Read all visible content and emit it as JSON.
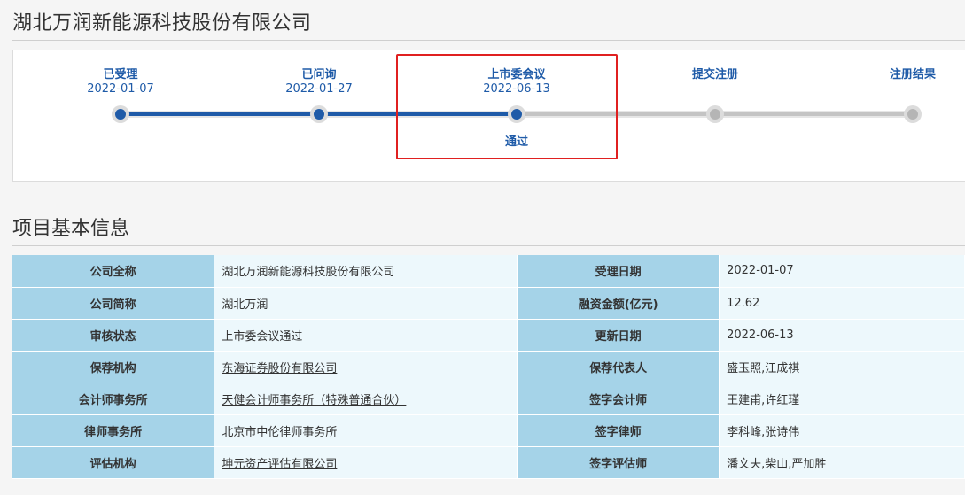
{
  "company_title": "湖北万润新能源科技股份有限公司",
  "steps": [
    {
      "label": "已受理",
      "date": "2022-01-07",
      "state": "done"
    },
    {
      "label": "已问询",
      "date": "2022-01-27",
      "state": "done"
    },
    {
      "label": "上市委会议",
      "date": "2022-06-13",
      "state": "done",
      "result": "通过"
    },
    {
      "label": "提交注册",
      "date": "",
      "state": "todo"
    },
    {
      "label": "注册结果",
      "date": "",
      "state": "todo"
    }
  ],
  "section_title": "项目基本信息",
  "info_rows": [
    {
      "left_label": "公司全称",
      "left_value": "湖北万润新能源科技股份有限公司",
      "left_link": false,
      "right_label": "受理日期",
      "right_value": "2022-01-07"
    },
    {
      "left_label": "公司简称",
      "left_value": "湖北万润",
      "left_link": false,
      "right_label": "融资金额(亿元)",
      "right_value": "12.62"
    },
    {
      "left_label": "审核状态",
      "left_value": "上市委会议通过",
      "left_link": false,
      "right_label": "更新日期",
      "right_value": "2022-06-13"
    },
    {
      "left_label": "保荐机构",
      "left_value": "东海证券股份有限公司",
      "left_link": true,
      "right_label": "保荐代表人",
      "right_value": "盛玉照,江成祺"
    },
    {
      "left_label": "会计师事务所",
      "left_value": "天健会计师事务所（特殊普通合伙）",
      "left_link": true,
      "right_label": "签字会计师",
      "right_value": "王建甫,许红瑾"
    },
    {
      "left_label": "律师事务所",
      "left_value": "北京市中伦律师事务所",
      "left_link": true,
      "right_label": "签字律师",
      "right_value": "李科峰,张诗伟"
    },
    {
      "left_label": "评估机构",
      "left_value": "坤元资产评估有限公司",
      "left_link": true,
      "right_label": "签字评估师",
      "right_value": "潘文夫,柴山,严加胜"
    }
  ],
  "colors": {
    "accent": "#1f5ba8",
    "highlight": "#e02020",
    "key_cell": "#a5d3e8",
    "value_cell": "#edf8fc"
  }
}
